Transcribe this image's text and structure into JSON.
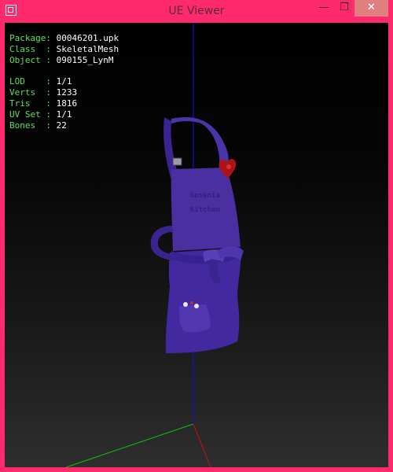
{
  "window": {
    "title": "UE Viewer",
    "minimize_glyph": "—",
    "maximize_glyph": "❐",
    "close_glyph": "✕"
  },
  "info": {
    "package_label": "Package: ",
    "package_value": "00046201.upk",
    "class_label": "Class  : ",
    "class_value": "SkeletalMesh",
    "object_label": "Object : ",
    "object_value": "090155_LynM",
    "lod_label": "LOD    : ",
    "lod_value": "1/1",
    "verts_label": "Verts  : ",
    "verts_value": "1233",
    "tris_label": "Tris   : ",
    "tris_value": "1816",
    "uvset_label": "UV Set : ",
    "uvset_value": "1/1",
    "bones_label": "Bones  : ",
    "bones_value": "22"
  },
  "colors": {
    "frame": "#ff2a6e",
    "info_label": "#5fe05f",
    "info_value": "#ffffff",
    "axis_x": "#d01010",
    "axis_y": "#10c010",
    "axis_z": "#1010c8",
    "mesh": "#4a2fa0"
  },
  "icons": [
    "app-icon",
    "minimize-icon",
    "maximize-icon",
    "close-icon"
  ]
}
